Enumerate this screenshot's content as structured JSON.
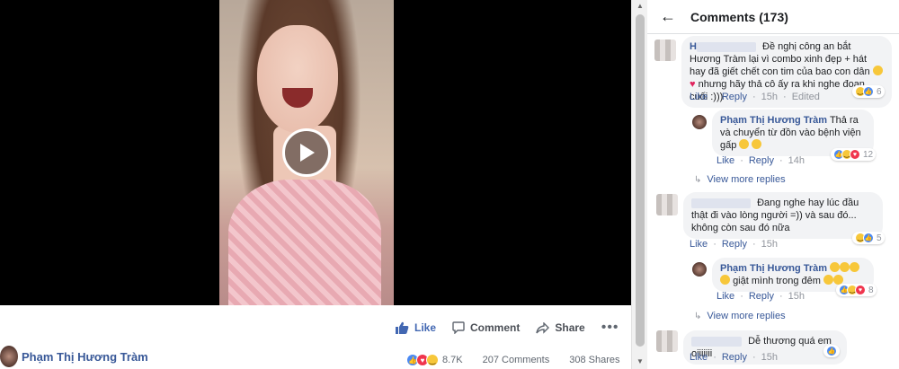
{
  "page": {
    "name": "Phạm Thị Hương Tràm"
  },
  "actions": {
    "like": "Like",
    "comment": "Comment",
    "share": "Share",
    "more": "•••"
  },
  "stats": {
    "reactions": "8.7K",
    "comments": "207 Comments",
    "shares": "308 Shares"
  },
  "comments_panel": {
    "title": "Comments (173)",
    "comments": [
      {
        "author_initial": "H",
        "text": "Đề nghị công an bắt Hương Tràm lại vì combo xinh đẹp + hát hay đã giết chết con tim của bao con dân",
        "text_tail": "nhưng hãy thả cô ấy ra khi nghe đoạn cuối :)))",
        "like": "Like",
        "reply": "Reply",
        "time": "15h",
        "edited": "Edited",
        "reaction_count": "6",
        "reply_item": {
          "author": "Phạm Thị Hương Tràm",
          "text": "Thả ra và chuyển từ đồn vào bệnh viện gấp",
          "like": "Like",
          "reply": "Reply",
          "time": "14h",
          "reaction_count": "12"
        },
        "more_replies": "View more replies"
      },
      {
        "text": "Đang nghe hay lúc đầu thật đi vào lòng người =)) và sau đó... không còn sau đó nữa",
        "like": "Like",
        "reply": "Reply",
        "time": "15h",
        "reaction_count": "5",
        "reply_item": {
          "author": "Phạm Thị Hương Tràm",
          "text": "giật mình trong đêm",
          "like": "Like",
          "reply": "Reply",
          "time": "15h",
          "reaction_count": "8"
        },
        "more_replies": "View more replies"
      },
      {
        "text": "Dễ thương quá em oiiiiiii",
        "like": "Like",
        "reply": "Reply",
        "time": "15h"
      }
    ]
  }
}
